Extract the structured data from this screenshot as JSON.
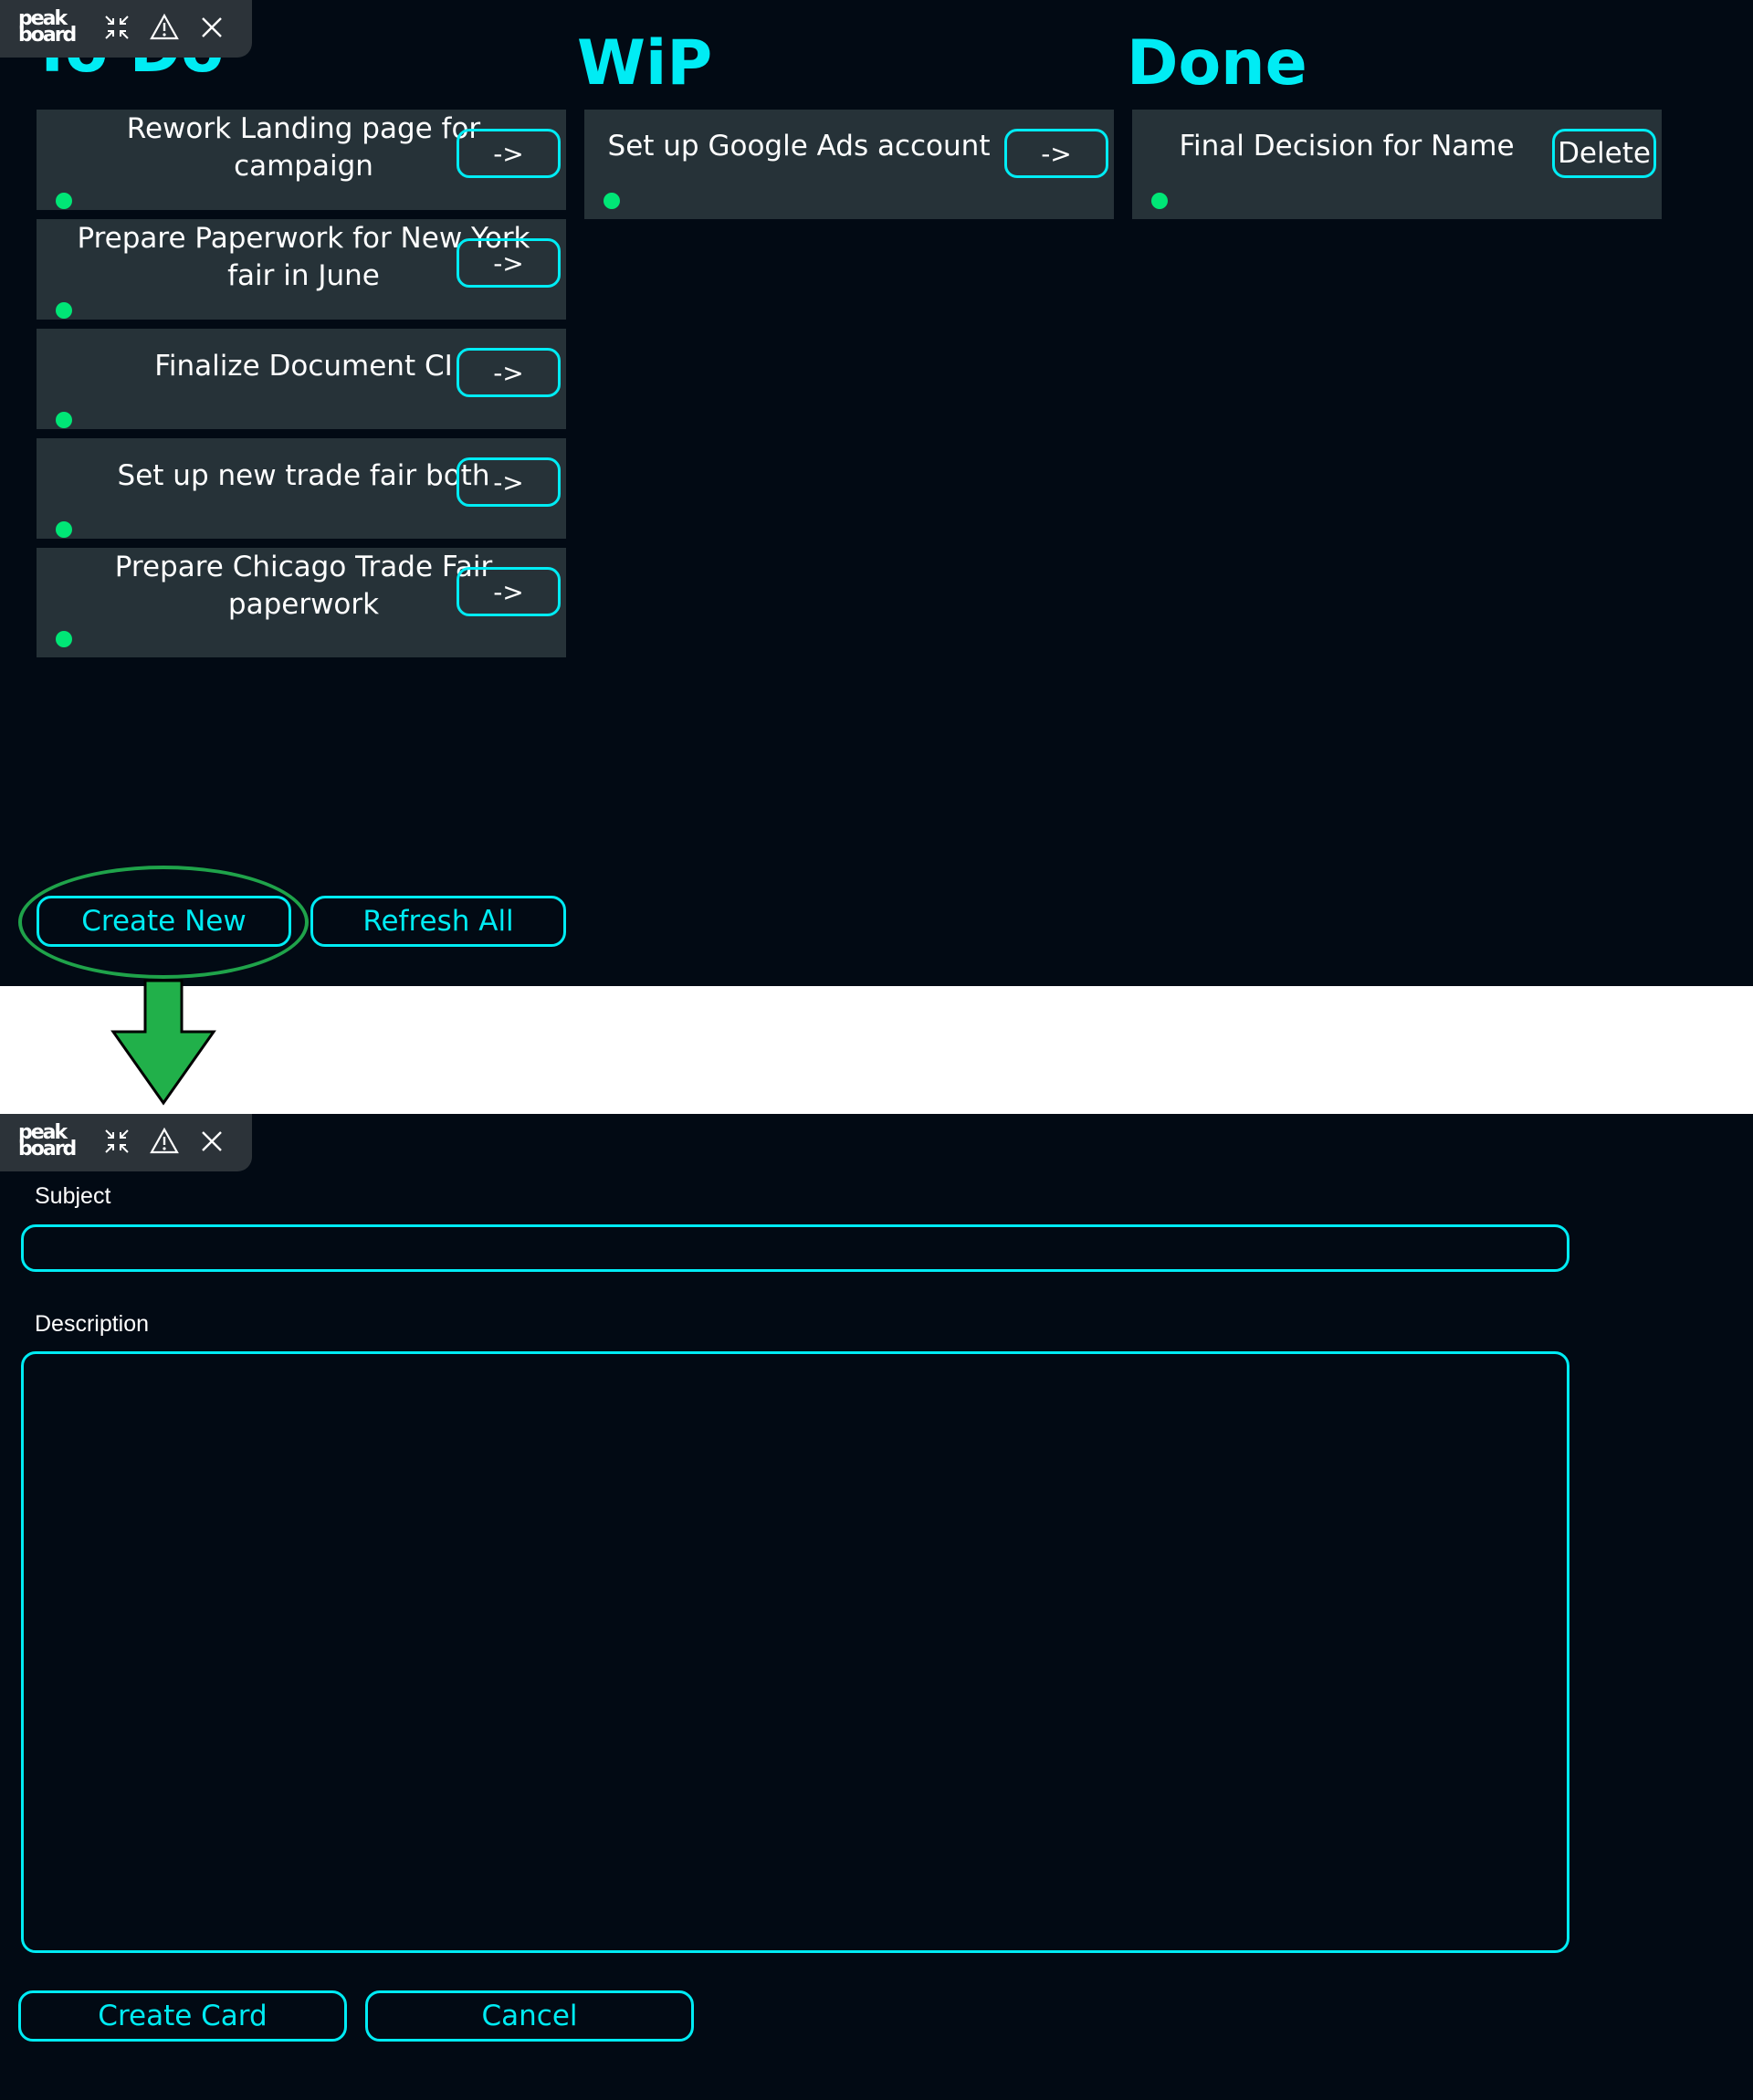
{
  "toolbar": {
    "logo_line1": "peak",
    "logo_line2": "board",
    "icons": [
      "collapse-icon",
      "warning-icon",
      "close-icon"
    ]
  },
  "kanban": {
    "columns": [
      {
        "title": "To Do",
        "cards": [
          {
            "text": "Rework Landing page for campaign",
            "button": "->"
          },
          {
            "text": "Prepare Paperwork for New York fair in June",
            "button": "->"
          },
          {
            "text": "Finalize Document CI",
            "button": "->"
          },
          {
            "text": "Set up new trade fair both",
            "button": "->"
          },
          {
            "text": "Prepare Chicago Trade Fair paperwork",
            "button": "->"
          }
        ]
      },
      {
        "title": "WiP",
        "cards": [
          {
            "text": "Set up Google Ads account",
            "button": "->"
          }
        ]
      },
      {
        "title": "Done",
        "cards": [
          {
            "text": "Final Decision for Name",
            "button": "Delete"
          }
        ]
      }
    ],
    "create_new_label": "Create New",
    "refresh_all_label": "Refresh All"
  },
  "form": {
    "subject_label": "Subject",
    "subject_value": "",
    "description_label": "Description",
    "description_value": "",
    "create_card_label": "Create Card",
    "cancel_label": "Cancel"
  },
  "colors": {
    "background": "#020a14",
    "accent": "#00ecf4",
    "card": "#263238",
    "status_dot": "#00e676",
    "highlight": "#1fa34a"
  }
}
